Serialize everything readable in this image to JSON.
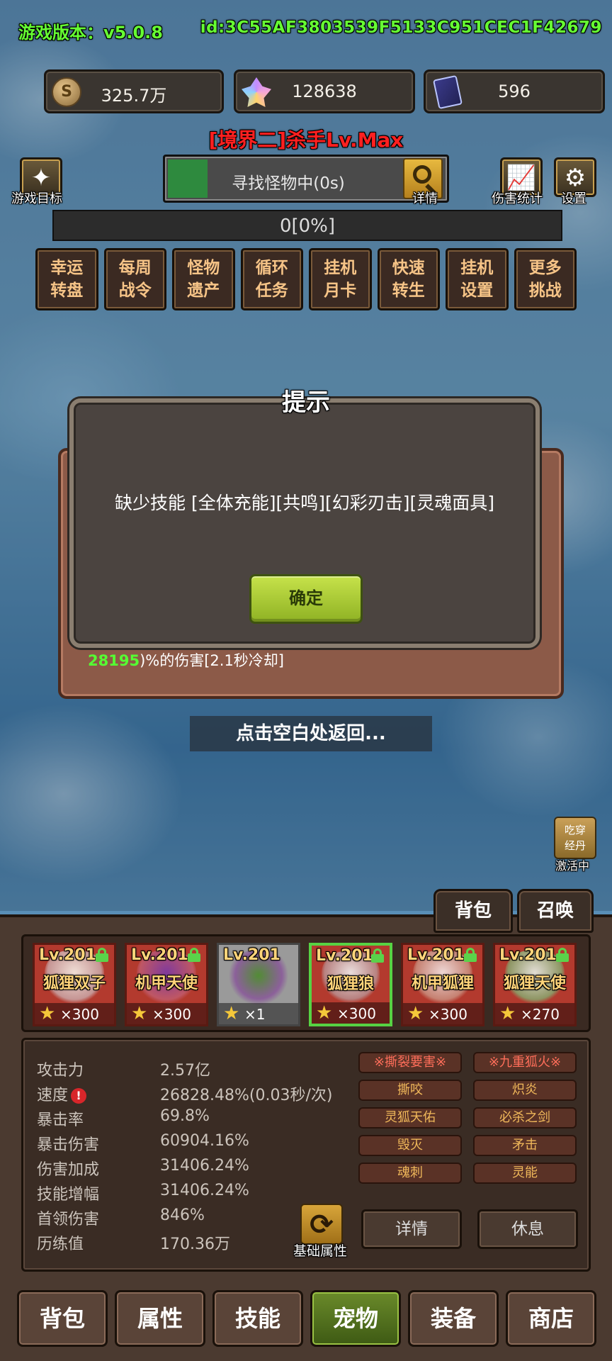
{
  "header": {
    "version": "游戏版本：v5.0.8",
    "user_id": "id:3C55AF3803539F5133C951CEC1F42679"
  },
  "resources": {
    "gold": "325.7万",
    "crystal": "128638",
    "cards": "596"
  },
  "realm_title": "[境界二]杀手Lv.Max",
  "toolbar": {
    "game_goal_label": "游戏目标",
    "search_status": "寻找怪物中(0s)",
    "detail_label": "详情",
    "damage_stats_label": "伤害统计",
    "settings_label": "设置"
  },
  "progress": {
    "text": "0[0%]",
    "fraction": 0
  },
  "menu": [
    {
      "label": "幸运\n转盘"
    },
    {
      "label": "每周\n战令"
    },
    {
      "label": "怪物\n遗产"
    },
    {
      "label": "循环\n任务"
    },
    {
      "label": "挂机\n月卡"
    },
    {
      "label": "快速\n转生"
    },
    {
      "label": "挂机\n设置"
    },
    {
      "label": "更多\n挑战"
    }
  ],
  "background_panel": {
    "skill_value": "28195",
    "skill_text": ")%的伤害[2.1秒冷却]"
  },
  "dialog": {
    "title": "提示",
    "message": "缺少技能 [全体充能][共鸣][幻彩刃击][灵魂面具]",
    "confirm_label": "确定"
  },
  "back_hint": "点击空白处返回...",
  "buff": {
    "badge": "吃穿\n经丹",
    "status": "激活中"
  },
  "tabs": {
    "bag": "背包",
    "summon": "召唤"
  },
  "pets": [
    {
      "level": "Lv.201",
      "name": "狐狸双子",
      "count": "×300",
      "style": "red"
    },
    {
      "level": "Lv.201",
      "name": "机甲天使",
      "count": "×300",
      "style": "red"
    },
    {
      "level": "Lv.201",
      "name": "",
      "count": "×1",
      "style": "gray"
    },
    {
      "level": "Lv.201",
      "name": "狐狸狼",
      "count": "×300",
      "style": "red"
    },
    {
      "level": "Lv.201",
      "name": "机甲狐狸",
      "count": "×300",
      "style": "red"
    },
    {
      "level": "Lv.201",
      "name": "狐狸天使",
      "count": "×270",
      "style": "red"
    }
  ],
  "stats": [
    {
      "label": "攻击力",
      "value": "2.57亿"
    },
    {
      "label": "速度",
      "value": "26828.48%(0.03秒/次)"
    },
    {
      "label": "暴击率",
      "value": "69.8%"
    },
    {
      "label": "暴击伤害",
      "value": "60904.16%"
    },
    {
      "label": "伤害加成",
      "value": "31406.24%"
    },
    {
      "label": "技能增幅",
      "value": "31406.24%"
    },
    {
      "label": "首领伤害",
      "value": "846%"
    },
    {
      "label": "历练值",
      "value": "170.36万"
    }
  ],
  "skill_tags": [
    "※撕裂要害※",
    "※九重狐火※",
    "撕咬",
    "炽炎",
    "灵狐天佑",
    "必杀之剑",
    "毁灭",
    "矛击",
    "魂刺",
    "灵能"
  ],
  "base_attr_label": "基础属性",
  "actions": {
    "detail": "详情",
    "rest": "休息"
  },
  "nav": [
    {
      "label": "背包",
      "active": false
    },
    {
      "label": "属性",
      "active": false
    },
    {
      "label": "技能",
      "active": false
    },
    {
      "label": "宠物",
      "active": true
    },
    {
      "label": "装备",
      "active": false
    },
    {
      "label": "商店",
      "active": false
    }
  ]
}
